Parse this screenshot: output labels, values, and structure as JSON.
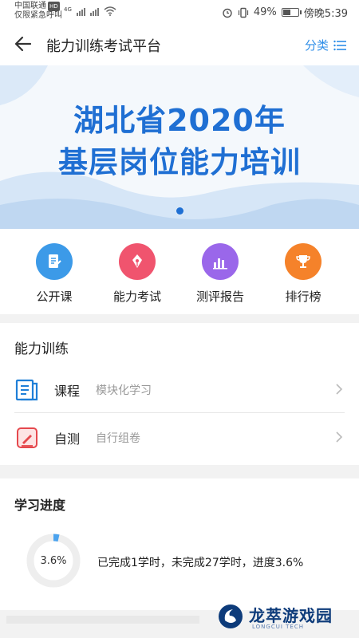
{
  "status_bar": {
    "carrier": "中国联通",
    "hd_badge": "HD",
    "emergency": "仅限紧急呼叫",
    "network": "4G",
    "battery": "49%",
    "time": "傍晚5:39"
  },
  "header": {
    "title": "能力训练考试平台",
    "category_label": "分类"
  },
  "banner": {
    "line1": "湖北省2020年",
    "line2": "基层岗位能力培训",
    "page_count": 1,
    "active_index": 0
  },
  "quick_menu": [
    {
      "label": "公开课",
      "icon": "document-icon",
      "color": "#3c9ae8"
    },
    {
      "label": "能力考试",
      "icon": "pen-icon",
      "color": "#f0546e"
    },
    {
      "label": "测评报告",
      "icon": "bar-chart-icon",
      "color": "#9a67ea"
    },
    {
      "label": "排行榜",
      "icon": "trophy-icon",
      "color": "#f5822a"
    }
  ],
  "training": {
    "title": "能力训练",
    "items": [
      {
        "name": "课程",
        "desc": "模块化学习",
        "icon": "course-book-icon"
      },
      {
        "name": "自测",
        "desc": "自行组卷",
        "icon": "self-test-icon"
      }
    ]
  },
  "progress": {
    "title": "学习进度",
    "percent_label": "3.6%",
    "percent_value": 3.6,
    "summary": "已完成1学时，未完成27学时，进度3.6%"
  },
  "watermark": {
    "title": "龙萃游戏园",
    "subtitle": "LONGCUI TECH"
  },
  "colors": {
    "accent": "#2e8ee8",
    "banner_text": "#1f6fd3"
  }
}
